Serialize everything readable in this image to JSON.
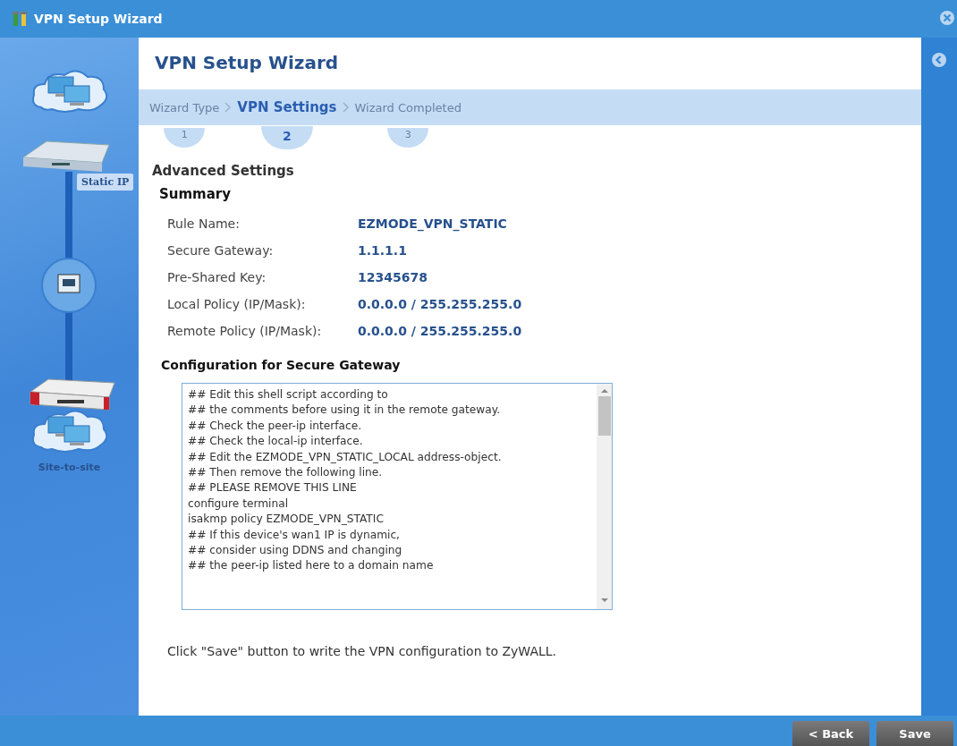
{
  "window": {
    "title": "VPN Setup Wizard"
  },
  "sidebar": {
    "device_label": "Static IP",
    "mode_label": "Site-to-site"
  },
  "wizard": {
    "title": "VPN Setup Wizard",
    "steps": [
      {
        "label": "Wizard Type",
        "number": "1",
        "selected": false
      },
      {
        "label": "VPN Settings",
        "number": "2",
        "selected": true
      },
      {
        "label": "Wizard Completed",
        "number": "3",
        "selected": false
      }
    ],
    "section_title": "Advanced Settings",
    "summary_title": "Summary",
    "summary": [
      {
        "label": "Rule Name:",
        "value": "EZMODE_VPN_STATIC"
      },
      {
        "label": "Secure Gateway:",
        "value": "1.1.1.1"
      },
      {
        "label": "Pre-Shared Key:",
        "value": "12345678"
      },
      {
        "label": "Local Policy (IP/Mask):",
        "value": "0.0.0.0 / 255.255.255.0"
      },
      {
        "label": "Remote Policy (IP/Mask):",
        "value": "0.0.0.0 / 255.255.255.0"
      }
    ],
    "config_title": "Configuration for Secure Gateway",
    "config_lines": [
      "## Edit this shell script according to",
      "## the comments before using it in the remote gateway.",
      "## Check the peer-ip interface.",
      "## Check the local-ip interface.",
      "## Edit the EZMODE_VPN_STATIC_LOCAL address-object.",
      "## Then remove the following line.",
      "## PLEASE REMOVE THIS LINE",
      "configure terminal",
      "isakmp policy EZMODE_VPN_STATIC",
      "## If this device's wan1 IP is dynamic,",
      "## consider using DDNS and changing",
      "## the peer-ip listed here to a domain name"
    ],
    "note": "Click \"Save\" button to write the VPN configuration to ZyWALL."
  },
  "buttons": [
    "< Back",
    "Save"
  ]
}
